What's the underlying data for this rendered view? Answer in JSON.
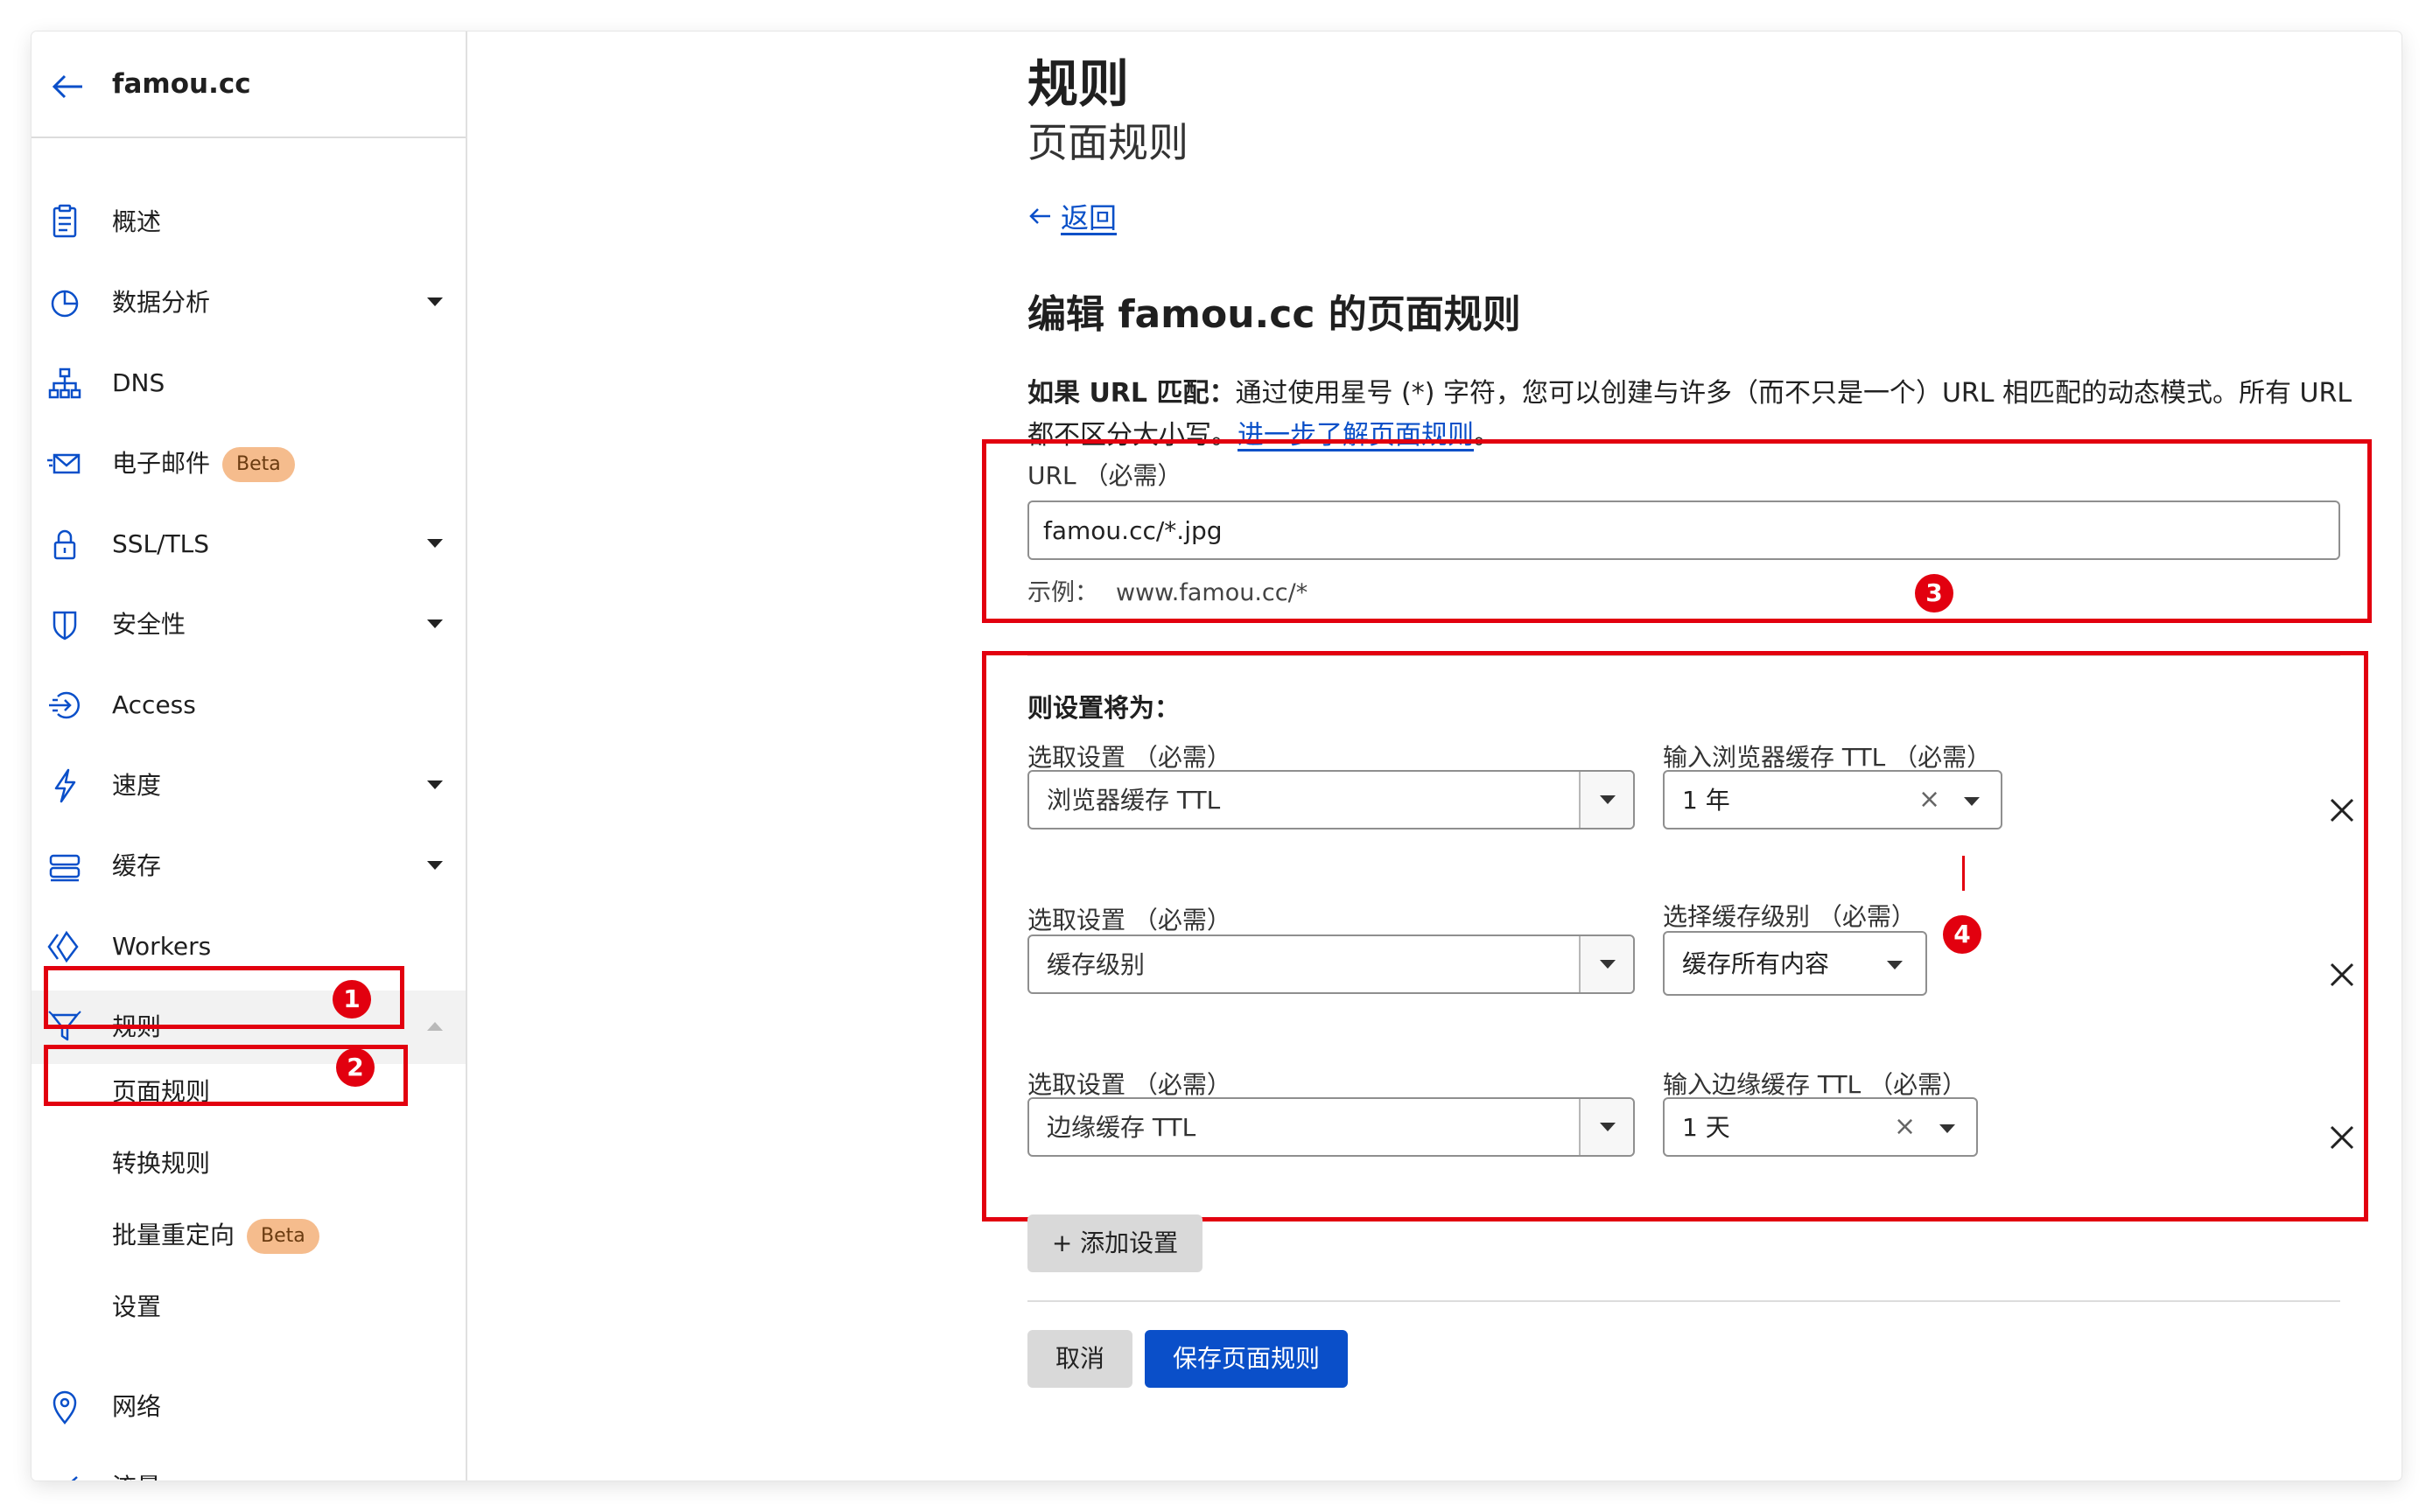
{
  "sidebar": {
    "domain": "famou.cc",
    "items": [
      {
        "label": "概述",
        "icon": "document-icon"
      },
      {
        "label": "数据分析",
        "icon": "pie-chart-icon"
      },
      {
        "label": "DNS",
        "icon": "network-tree-icon"
      },
      {
        "label": "电子邮件",
        "icon": "email-icon",
        "badge": "Beta"
      },
      {
        "label": "SSL/TLS",
        "icon": "lock-icon"
      },
      {
        "label": "安全性",
        "icon": "shield-icon"
      },
      {
        "label": "Access",
        "icon": "access-icon"
      },
      {
        "label": "速度",
        "icon": "lightning-icon"
      },
      {
        "label": "缓存",
        "icon": "storage-icon"
      },
      {
        "label": "Workers",
        "icon": "workers-icon"
      },
      {
        "label": "规则",
        "icon": "rules-funnel-icon"
      },
      {
        "label": "网络",
        "icon": "location-pin-icon"
      },
      {
        "label": "流量",
        "icon": "traffic-icon"
      }
    ],
    "rules_sub": [
      {
        "label": "页面规则"
      },
      {
        "label": "转换规则"
      },
      {
        "label": "批量重定向",
        "badge": "Beta"
      },
      {
        "label": "设置"
      }
    ]
  },
  "annotations": [
    "1",
    "2",
    "3",
    "4"
  ],
  "main": {
    "title": "规则",
    "subtitle": "页面规则",
    "back_label": "返回",
    "heading": "编辑 famou.cc 的页面规则",
    "desc_bold": "如果 URL 匹配：",
    "desc_text": "通过使用星号 (*) 字符，您可以创建与许多（而不只是一个）URL 相匹配的动态模式。所有 URL 都不区分大小写。",
    "desc_link": "进一步了解页面规则",
    "desc_end": "。",
    "url_label": "URL （必需）",
    "url_value": "famou.cc/*.jpg",
    "hint_label": "示例：",
    "hint_value": "www.famou.cc/*",
    "settings_title": "则设置将为：",
    "settings": [
      {
        "select_label": "选取设置 （必需）",
        "select_value": "浏览器缓存 TTL",
        "value_label": "输入浏览器缓存 TTL （必需）",
        "value": "1 年"
      },
      {
        "select_label": "选取设置 （必需）",
        "select_value": "缓存级别",
        "value_label": "选择缓存级别 （必需）",
        "value": "缓存所有内容"
      },
      {
        "select_label": "选取设置 （必需）",
        "select_value": "边缘缓存 TTL",
        "value_label": "输入边缘缓存 TTL （必需）",
        "value": "1 天"
      }
    ],
    "clear_symbol": "×",
    "add_setting": "+ 添加设置",
    "cancel": "取消",
    "save": "保存页面规则"
  },
  "colors": {
    "accent": "#0a4fc9",
    "annotation": "#e2000f",
    "badge": "#f5bc8d"
  }
}
